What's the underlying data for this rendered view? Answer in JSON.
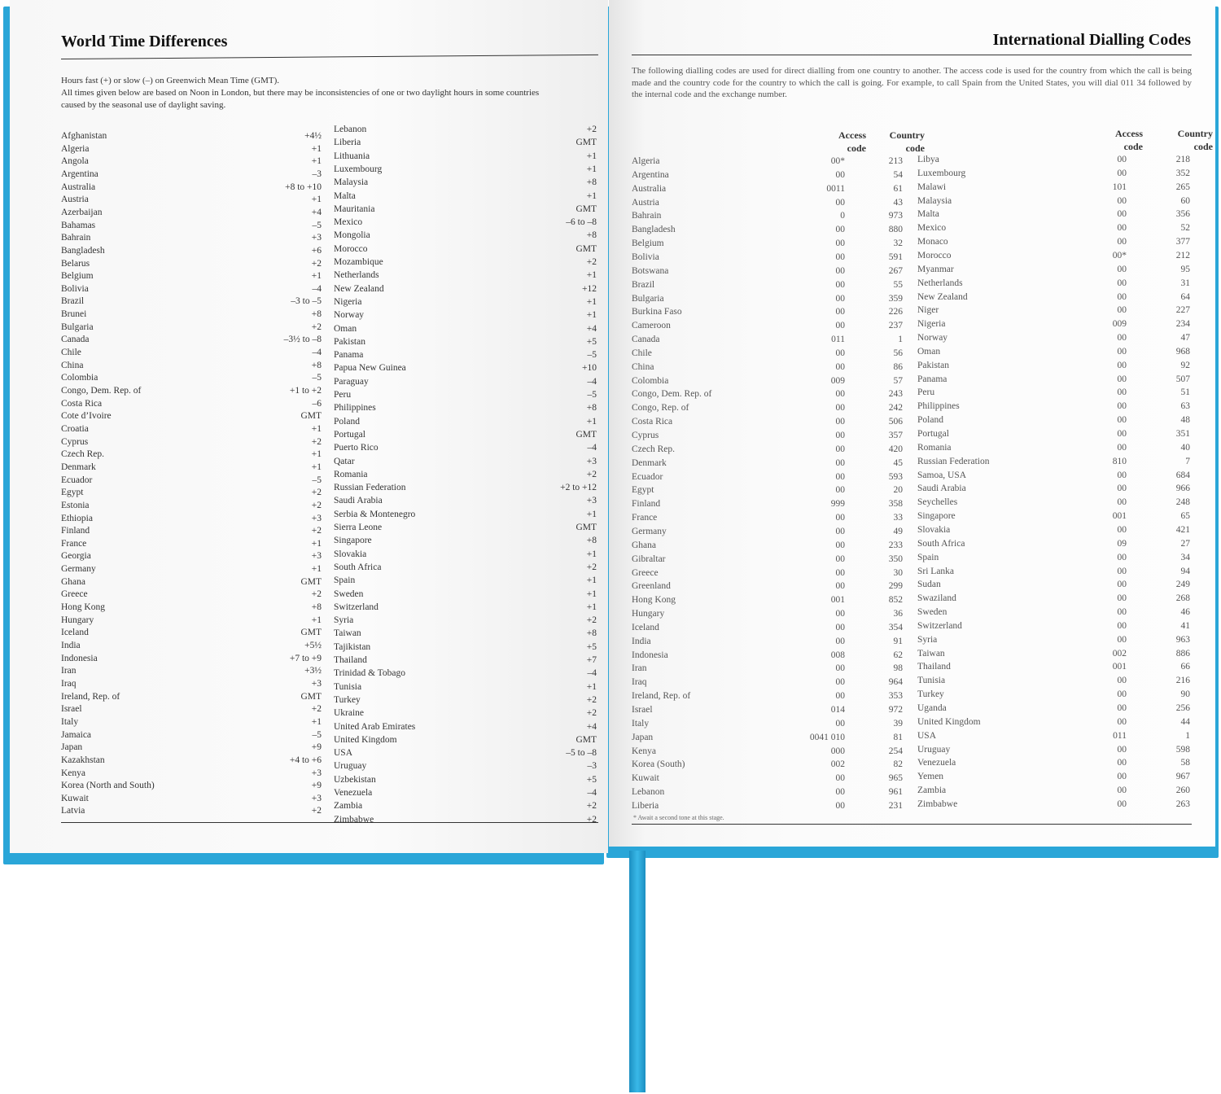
{
  "left_page": {
    "title": "World Time Differences",
    "intro": [
      "Hours fast (+) or slow (–) on Greenwich Mean Time (GMT).",
      "All times given below are based on Noon in London, but there may be inconsistencies of one or two daylight hours in some countries",
      "caused by the seasonal use of daylight saving."
    ],
    "col1": [
      {
        "name": "Afghanistan",
        "diff": "+4½"
      },
      {
        "name": "Algeria",
        "diff": "+1"
      },
      {
        "name": "Angola",
        "diff": "+1"
      },
      {
        "name": "Argentina",
        "diff": "–3"
      },
      {
        "name": "Australia",
        "diff": "+8 to +10"
      },
      {
        "name": "Austria",
        "diff": "+1"
      },
      {
        "name": "Azerbaijan",
        "diff": "+4"
      },
      {
        "name": "Bahamas",
        "diff": "–5"
      },
      {
        "name": "Bahrain",
        "diff": "+3"
      },
      {
        "name": "Bangladesh",
        "diff": "+6"
      },
      {
        "name": "Belarus",
        "diff": "+2"
      },
      {
        "name": "Belgium",
        "diff": "+1"
      },
      {
        "name": "Bolivia",
        "diff": "–4"
      },
      {
        "name": "Brazil",
        "diff": "–3 to –5"
      },
      {
        "name": "Brunei",
        "diff": "+8"
      },
      {
        "name": "Bulgaria",
        "diff": "+2"
      },
      {
        "name": "Canada",
        "diff": "–3½ to –8"
      },
      {
        "name": "Chile",
        "diff": "–4"
      },
      {
        "name": "China",
        "diff": "+8"
      },
      {
        "name": "Colombia",
        "diff": "–5"
      },
      {
        "name": "Congo, Dem. Rep. of",
        "diff": "+1 to +2"
      },
      {
        "name": "Costa Rica",
        "diff": "–6"
      },
      {
        "name": "Cote d’Ivoire",
        "diff": "GMT"
      },
      {
        "name": "Croatia",
        "diff": "+1"
      },
      {
        "name": "Cyprus",
        "diff": "+2"
      },
      {
        "name": "Czech Rep.",
        "diff": "+1"
      },
      {
        "name": "Denmark",
        "diff": "+1"
      },
      {
        "name": "Ecuador",
        "diff": "–5"
      },
      {
        "name": "Egypt",
        "diff": "+2"
      },
      {
        "name": "Estonia",
        "diff": "+2"
      },
      {
        "name": "Ethiopia",
        "diff": "+3"
      },
      {
        "name": "Finland",
        "diff": "+2"
      },
      {
        "name": "France",
        "diff": "+1"
      },
      {
        "name": "Georgia",
        "diff": "+3"
      },
      {
        "name": "Germany",
        "diff": "+1"
      },
      {
        "name": "Ghana",
        "diff": "GMT"
      },
      {
        "name": "Greece",
        "diff": "+2"
      },
      {
        "name": "Hong Kong",
        "diff": "+8"
      },
      {
        "name": "Hungary",
        "diff": "+1"
      },
      {
        "name": "Iceland",
        "diff": "GMT"
      },
      {
        "name": "India",
        "diff": "+5½"
      },
      {
        "name": "Indonesia",
        "diff": "+7 to +9"
      },
      {
        "name": "Iran",
        "diff": "+3½"
      },
      {
        "name": "Iraq",
        "diff": "+3"
      },
      {
        "name": "Ireland, Rep. of",
        "diff": "GMT"
      },
      {
        "name": "Israel",
        "diff": "+2"
      },
      {
        "name": "Italy",
        "diff": "+1"
      },
      {
        "name": "Jamaica",
        "diff": "–5"
      },
      {
        "name": "Japan",
        "diff": "+9"
      },
      {
        "name": "Kazakhstan",
        "diff": "+4 to +6"
      },
      {
        "name": "Kenya",
        "diff": "+3"
      },
      {
        "name": "Korea (North and South)",
        "diff": "+9"
      },
      {
        "name": "Kuwait",
        "diff": "+3"
      },
      {
        "name": "Latvia",
        "diff": "+2"
      }
    ],
    "col2": [
      {
        "name": "Lebanon",
        "diff": "+2"
      },
      {
        "name": "Liberia",
        "diff": "GMT"
      },
      {
        "name": "Lithuania",
        "diff": "+1"
      },
      {
        "name": "Luxembourg",
        "diff": "+1"
      },
      {
        "name": "Malaysia",
        "diff": "+8"
      },
      {
        "name": "Malta",
        "diff": "+1"
      },
      {
        "name": "Mauritania",
        "diff": "GMT"
      },
      {
        "name": "Mexico",
        "diff": "–6 to –8"
      },
      {
        "name": "Mongolia",
        "diff": "+8"
      },
      {
        "name": "Morocco",
        "diff": "GMT"
      },
      {
        "name": "Mozambique",
        "diff": "+2"
      },
      {
        "name": "Netherlands",
        "diff": "+1"
      },
      {
        "name": "New Zealand",
        "diff": "+12"
      },
      {
        "name": "Nigeria",
        "diff": "+1"
      },
      {
        "name": "Norway",
        "diff": "+1"
      },
      {
        "name": "Oman",
        "diff": "+4"
      },
      {
        "name": "Pakistan",
        "diff": "+5"
      },
      {
        "name": "Panama",
        "diff": "–5"
      },
      {
        "name": "Papua New Guinea",
        "diff": "+10"
      },
      {
        "name": "Paraguay",
        "diff": "–4"
      },
      {
        "name": "Peru",
        "diff": "–5"
      },
      {
        "name": "Philippines",
        "diff": "+8"
      },
      {
        "name": "Poland",
        "diff": "+1"
      },
      {
        "name": "Portugal",
        "diff": "GMT"
      },
      {
        "name": "Puerto Rico",
        "diff": "–4"
      },
      {
        "name": "Qatar",
        "diff": "+3"
      },
      {
        "name": "Romania",
        "diff": "+2"
      },
      {
        "name": "Russian Federation",
        "diff": "+2 to +12"
      },
      {
        "name": "Saudi Arabia",
        "diff": "+3"
      },
      {
        "name": "Serbia & Montenegro",
        "diff": "+1"
      },
      {
        "name": "Sierra Leone",
        "diff": "GMT"
      },
      {
        "name": "Singapore",
        "diff": "+8"
      },
      {
        "name": "Slovakia",
        "diff": "+1"
      },
      {
        "name": "South Africa",
        "diff": "+2"
      },
      {
        "name": "Spain",
        "diff": "+1"
      },
      {
        "name": "Sweden",
        "diff": "+1"
      },
      {
        "name": "Switzerland",
        "diff": "+1"
      },
      {
        "name": "Syria",
        "diff": "+2"
      },
      {
        "name": "Taiwan",
        "diff": "+8"
      },
      {
        "name": "Tajikistan",
        "diff": "+5"
      },
      {
        "name": "Thailand",
        "diff": "+7"
      },
      {
        "name": "Trinidad & Tobago",
        "diff": "–4"
      },
      {
        "name": "Tunisia",
        "diff": "+1"
      },
      {
        "name": "Turkey",
        "diff": "+2"
      },
      {
        "name": "Ukraine",
        "diff": "+2"
      },
      {
        "name": "United Arab Emirates",
        "diff": "+4"
      },
      {
        "name": "United Kingdom",
        "diff": "GMT"
      },
      {
        "name": "USA",
        "diff": "–5 to –8"
      },
      {
        "name": "Uruguay",
        "diff": "–3"
      },
      {
        "name": "Uzbekistan",
        "diff": "+5"
      },
      {
        "name": "Venezuela",
        "diff": "–4"
      },
      {
        "name": "Zambia",
        "diff": "+2"
      },
      {
        "name": "Zimbabwe",
        "diff": "+2"
      }
    ]
  },
  "right_page": {
    "title": "International Dialling Codes",
    "intro": "The following dialling codes are used for direct dialling from one country to another. The access code is used for the country from which the call is being made and the country code for the country to which the call is going. For example, to call Spain from the United States, you will dial 011 34 followed by the internal code and the exchange number.",
    "headers": {
      "access_1": "Access",
      "access_2": "code",
      "country_1": "Country",
      "country_2": "code"
    },
    "col1": [
      {
        "name": "Algeria",
        "access": "00*",
        "code": "213"
      },
      {
        "name": "Argentina",
        "access": "00",
        "code": "54"
      },
      {
        "name": "Australia",
        "access": "0011",
        "code": "61"
      },
      {
        "name": "Austria",
        "access": "00",
        "code": "43"
      },
      {
        "name": "Bahrain",
        "access": "0",
        "code": "973"
      },
      {
        "name": "Bangladesh",
        "access": "00",
        "code": "880"
      },
      {
        "name": "Belgium",
        "access": "00",
        "code": "32"
      },
      {
        "name": "Bolivia",
        "access": "00",
        "code": "591"
      },
      {
        "name": "Botswana",
        "access": "00",
        "code": "267"
      },
      {
        "name": "Brazil",
        "access": "00",
        "code": "55"
      },
      {
        "name": "Bulgaria",
        "access": "00",
        "code": "359"
      },
      {
        "name": "Burkina Faso",
        "access": "00",
        "code": "226"
      },
      {
        "name": "Cameroon",
        "access": "00",
        "code": "237"
      },
      {
        "name": "Canada",
        "access": "011",
        "code": "1"
      },
      {
        "name": "Chile",
        "access": "00",
        "code": "56"
      },
      {
        "name": "China",
        "access": "00",
        "code": "86"
      },
      {
        "name": "Colombia",
        "access": "009",
        "code": "57"
      },
      {
        "name": "Congo, Dem. Rep. of",
        "access": "00",
        "code": "243"
      },
      {
        "name": "Congo, Rep. of",
        "access": "00",
        "code": "242"
      },
      {
        "name": "Costa Rica",
        "access": "00",
        "code": "506"
      },
      {
        "name": "Cyprus",
        "access": "00",
        "code": "357"
      },
      {
        "name": "Czech Rep.",
        "access": "00",
        "code": "420"
      },
      {
        "name": "Denmark",
        "access": "00",
        "code": "45"
      },
      {
        "name": "Ecuador",
        "access": "00",
        "code": "593"
      },
      {
        "name": "Egypt",
        "access": "00",
        "code": "20"
      },
      {
        "name": "Finland",
        "access": "999",
        "code": "358"
      },
      {
        "name": "France",
        "access": "00",
        "code": "33"
      },
      {
        "name": "Germany",
        "access": "00",
        "code": "49"
      },
      {
        "name": "Ghana",
        "access": "00",
        "code": "233"
      },
      {
        "name": "Gibraltar",
        "access": "00",
        "code": "350"
      },
      {
        "name": "Greece",
        "access": "00",
        "code": "30"
      },
      {
        "name": "Greenland",
        "access": "00",
        "code": "299"
      },
      {
        "name": "Hong Kong",
        "access": "001",
        "code": "852"
      },
      {
        "name": "Hungary",
        "access": "00",
        "code": "36"
      },
      {
        "name": "Iceland",
        "access": "00",
        "code": "354"
      },
      {
        "name": "India",
        "access": "00",
        "code": "91"
      },
      {
        "name": "Indonesia",
        "access": "008",
        "code": "62"
      },
      {
        "name": "Iran",
        "access": "00",
        "code": "98"
      },
      {
        "name": "Iraq",
        "access": "00",
        "code": "964"
      },
      {
        "name": "Ireland, Rep. of",
        "access": "00",
        "code": "353"
      },
      {
        "name": "Israel",
        "access": "014",
        "code": "972"
      },
      {
        "name": "Italy",
        "access": "00",
        "code": "39"
      },
      {
        "name": "Japan",
        "access": "0041 010",
        "code": "81"
      },
      {
        "name": "Kenya",
        "access": "000",
        "code": "254"
      },
      {
        "name": "Korea (South)",
        "access": "002",
        "code": "82"
      },
      {
        "name": "Kuwait",
        "access": "00",
        "code": "965"
      },
      {
        "name": "Lebanon",
        "access": "00",
        "code": "961"
      },
      {
        "name": "Liberia",
        "access": "00",
        "code": "231"
      }
    ],
    "col2": [
      {
        "name": "Libya",
        "access": "00",
        "code": "218"
      },
      {
        "name": "Luxembourg",
        "access": "00",
        "code": "352"
      },
      {
        "name": "Malawi",
        "access": "101",
        "code": "265"
      },
      {
        "name": "Malaysia",
        "access": "00",
        "code": "60"
      },
      {
        "name": "Malta",
        "access": "00",
        "code": "356"
      },
      {
        "name": "Mexico",
        "access": "00",
        "code": "52"
      },
      {
        "name": "Monaco",
        "access": "00",
        "code": "377"
      },
      {
        "name": "Morocco",
        "access": "00*",
        "code": "212"
      },
      {
        "name": "Myanmar",
        "access": "00",
        "code": "95"
      },
      {
        "name": "Netherlands",
        "access": "00",
        "code": "31"
      },
      {
        "name": "New Zealand",
        "access": "00",
        "code": "64"
      },
      {
        "name": "Niger",
        "access": "00",
        "code": "227"
      },
      {
        "name": "Nigeria",
        "access": "009",
        "code": "234"
      },
      {
        "name": "Norway",
        "access": "00",
        "code": "47"
      },
      {
        "name": "Oman",
        "access": "00",
        "code": "968"
      },
      {
        "name": "Pakistan",
        "access": "00",
        "code": "92"
      },
      {
        "name": "Panama",
        "access": "00",
        "code": "507"
      },
      {
        "name": "Peru",
        "access": "00",
        "code": "51"
      },
      {
        "name": "Philippines",
        "access": "00",
        "code": "63"
      },
      {
        "name": "Poland",
        "access": "00",
        "code": "48"
      },
      {
        "name": "Portugal",
        "access": "00",
        "code": "351"
      },
      {
        "name": "Romania",
        "access": "00",
        "code": "40"
      },
      {
        "name": "Russian Federation",
        "access": "810",
        "code": "7"
      },
      {
        "name": "Samoa, USA",
        "access": "00",
        "code": "684"
      },
      {
        "name": "Saudi Arabia",
        "access": "00",
        "code": "966"
      },
      {
        "name": "Seychelles",
        "access": "00",
        "code": "248"
      },
      {
        "name": "Singapore",
        "access": "001",
        "code": "65"
      },
      {
        "name": "Slovakia",
        "access": "00",
        "code": "421"
      },
      {
        "name": "South Africa",
        "access": "09",
        "code": "27"
      },
      {
        "name": "Spain",
        "access": "00",
        "code": "34"
      },
      {
        "name": "Sri Lanka",
        "access": "00",
        "code": "94"
      },
      {
        "name": "Sudan",
        "access": "00",
        "code": "249"
      },
      {
        "name": "Swaziland",
        "access": "00",
        "code": "268"
      },
      {
        "name": "Sweden",
        "access": "00",
        "code": "46"
      },
      {
        "name": "Switzerland",
        "access": "00",
        "code": "41"
      },
      {
        "name": "Syria",
        "access": "00",
        "code": "963"
      },
      {
        "name": "Taiwan",
        "access": "002",
        "code": "886"
      },
      {
        "name": "Thailand",
        "access": "001",
        "code": "66"
      },
      {
        "name": "Tunisia",
        "access": "00",
        "code": "216"
      },
      {
        "name": "Turkey",
        "access": "00",
        "code": "90"
      },
      {
        "name": "Uganda",
        "access": "00",
        "code": "256"
      },
      {
        "name": "United Kingdom",
        "access": "00",
        "code": "44"
      },
      {
        "name": "USA",
        "access": "011",
        "code": "1"
      },
      {
        "name": "Uruguay",
        "access": "00",
        "code": "598"
      },
      {
        "name": "Venezuela",
        "access": "00",
        "code": "58"
      },
      {
        "name": "Yemen",
        "access": "00",
        "code": "967"
      },
      {
        "name": "Zambia",
        "access": "00",
        "code": "260"
      },
      {
        "name": "Zimbabwe",
        "access": "00",
        "code": "263"
      }
    ],
    "footnote": "* Await a second tone at this stage."
  },
  "colors": {
    "cover": "#2aa6d8",
    "ribbon": "#2aa6d8",
    "text": "#222222",
    "page": "#fbfbfb"
  }
}
